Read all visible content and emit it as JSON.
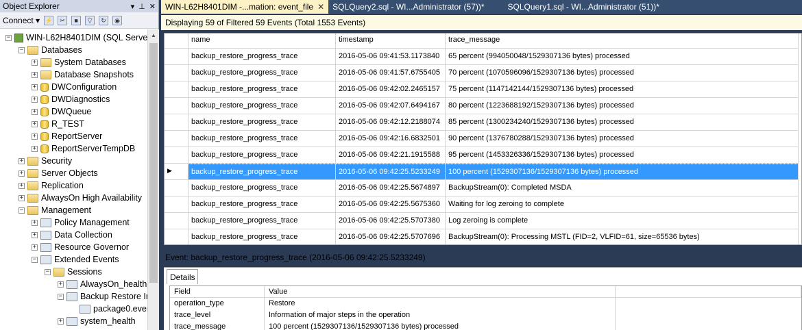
{
  "object_explorer": {
    "title": "Object Explorer",
    "pin_icon": "pin-icon",
    "close_icon": "close-icon",
    "connect_label": "Connect",
    "tree": [
      {
        "label": "WIN-L62H8401DIM (SQL Server",
        "icon": "server-icon",
        "depth": 0,
        "expanded": true
      },
      {
        "label": "Databases",
        "icon": "folder-icon",
        "depth": 1,
        "expanded": true
      },
      {
        "label": "System Databases",
        "icon": "folder-icon",
        "depth": 2,
        "expanded": false
      },
      {
        "label": "Database Snapshots",
        "icon": "folder-icon",
        "depth": 2,
        "expanded": false
      },
      {
        "label": "DWConfiguration",
        "icon": "database-icon",
        "depth": 2,
        "expanded": false
      },
      {
        "label": "DWDiagnostics",
        "icon": "database-icon",
        "depth": 2,
        "expanded": false
      },
      {
        "label": "DWQueue",
        "icon": "database-icon",
        "depth": 2,
        "expanded": false
      },
      {
        "label": "R_TEST",
        "icon": "database-icon",
        "depth": 2,
        "expanded": false
      },
      {
        "label": "ReportServer",
        "icon": "database-icon",
        "depth": 2,
        "expanded": false
      },
      {
        "label": "ReportServerTempDB",
        "icon": "database-icon",
        "depth": 2,
        "expanded": false
      },
      {
        "label": "Security",
        "icon": "folder-icon",
        "depth": 1,
        "expanded": false
      },
      {
        "label": "Server Objects",
        "icon": "folder-icon",
        "depth": 1,
        "expanded": false
      },
      {
        "label": "Replication",
        "icon": "folder-icon",
        "depth": 1,
        "expanded": false
      },
      {
        "label": "AlwaysOn High Availability",
        "icon": "folder-icon",
        "depth": 1,
        "expanded": false
      },
      {
        "label": "Management",
        "icon": "folder-icon",
        "depth": 1,
        "expanded": true
      },
      {
        "label": "Policy Management",
        "icon": "policy-icon",
        "depth": 2,
        "expanded": false
      },
      {
        "label": "Data Collection",
        "icon": "data-collection-icon",
        "depth": 2,
        "expanded": false
      },
      {
        "label": "Resource Governor",
        "icon": "resource-governor-icon",
        "depth": 2,
        "expanded": false
      },
      {
        "label": "Extended Events",
        "icon": "extended-events-icon",
        "depth": 2,
        "expanded": true
      },
      {
        "label": "Sessions",
        "icon": "folder-icon",
        "depth": 3,
        "expanded": true
      },
      {
        "label": "AlwaysOn_health",
        "icon": "session-icon",
        "depth": 4,
        "expanded": false
      },
      {
        "label": "Backup Restore In",
        "icon": "session-icon",
        "depth": 4,
        "expanded": true
      },
      {
        "label": "package0.even",
        "icon": "target-icon",
        "depth": 5,
        "expanded": null
      },
      {
        "label": "system_health",
        "icon": "session-icon",
        "depth": 4,
        "expanded": false
      }
    ]
  },
  "tabs": [
    {
      "label": "WIN-L62H8401DIM -...mation: event_file",
      "active": true
    },
    {
      "label": "SQLQuery2.sql - WI...Administrator (57))*",
      "active": false
    },
    {
      "label": "SQLQuery1.sql - WI...Administrator (51))*",
      "active": false
    }
  ],
  "status": "Displaying 59 of Filtered 59 Events (Total 1553 Events)",
  "grid": {
    "columns": [
      "name",
      "timestamp",
      "trace_message"
    ],
    "rows": [
      [
        "backup_restore_progress_trace",
        "2016-05-06 09:41:53.1173840",
        "65 percent (994050048/1529307136 bytes) processed"
      ],
      [
        "backup_restore_progress_trace",
        "2016-05-06 09:41:57.6755405",
        "70 percent (1070596096/1529307136 bytes) processed"
      ],
      [
        "backup_restore_progress_trace",
        "2016-05-06 09:42:02.2465157",
        "75 percent (1147142144/1529307136 bytes) processed"
      ],
      [
        "backup_restore_progress_trace",
        "2016-05-06 09:42:07.6494167",
        "80 percent (1223688192/1529307136 bytes) processed"
      ],
      [
        "backup_restore_progress_trace",
        "2016-05-06 09:42:12.2188074",
        "85 percent (1300234240/1529307136 bytes) processed"
      ],
      [
        "backup_restore_progress_trace",
        "2016-05-06 09:42:16.6832501",
        "90 percent (1376780288/1529307136 bytes) processed"
      ],
      [
        "backup_restore_progress_trace",
        "2016-05-06 09:42:21.1915588",
        "95 percent (1453326336/1529307136 bytes) processed"
      ],
      [
        "backup_restore_progress_trace",
        "2016-05-06 09:42:25.5233249",
        "100 percent (1529307136/1529307136 bytes) processed"
      ],
      [
        "backup_restore_progress_trace",
        "2016-05-06 09:42:25.5674897",
        "BackupStream(0): Completed MSDA"
      ],
      [
        "backup_restore_progress_trace",
        "2016-05-06 09:42:25.5675360",
        "Waiting for log zeroing to complete"
      ],
      [
        "backup_restore_progress_trace",
        "2016-05-06 09:42:25.5707380",
        "Log zeroing is complete"
      ],
      [
        "backup_restore_progress_trace",
        "2016-05-06 09:42:25.5707696",
        "BackupStream(0): Processing MSTL (FID=2, VLFID=61, size=65536 bytes)"
      ]
    ],
    "selected_index": 7
  },
  "event_label": "Event: backup_restore_progress_trace (2016-05-06 09:42:25.5233249)",
  "details": {
    "tab_label": "Details",
    "columns": [
      "Field",
      "Value"
    ],
    "rows": [
      [
        "operation_type",
        "Restore"
      ],
      [
        "trace_level",
        "Information of major steps in the operation"
      ],
      [
        "trace_message",
        "100 percent (1529307136/1529307136 bytes) processed"
      ]
    ]
  }
}
